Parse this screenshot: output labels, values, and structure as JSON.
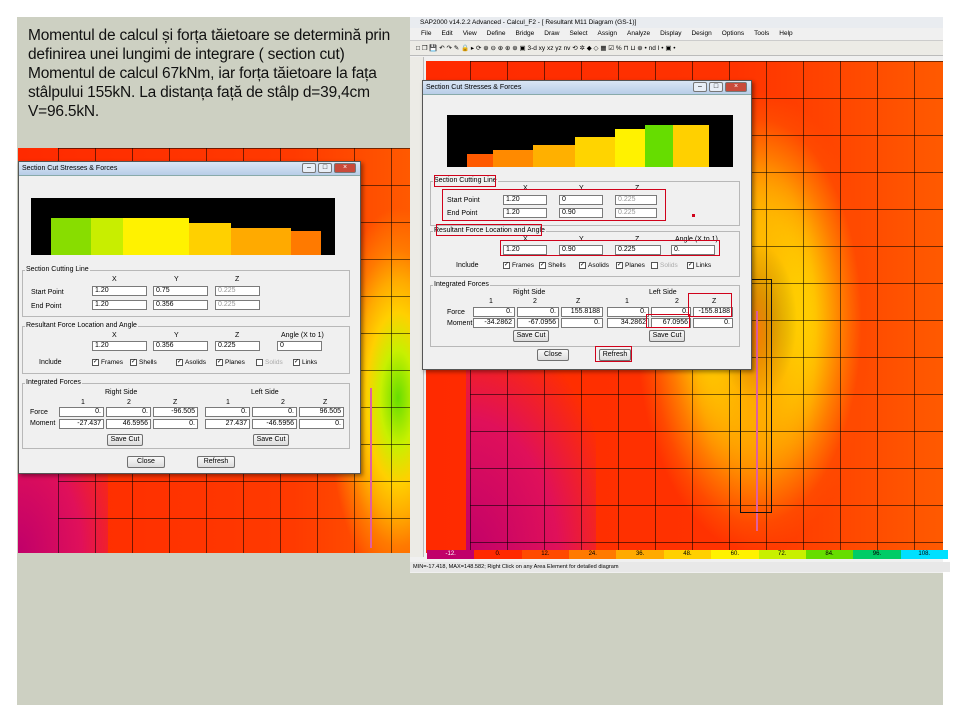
{
  "caption": {
    "line1": "Momentul de calcul și forța tăietoare se determină prin",
    "line2": "definirea unei lungimi de integrare ( section cut)",
    "line3": "Momentul de calcul 67kNm, iar forța tăietoare la fața",
    "line4": "stâlpului 155kN. La distanța față de stâlp d=39,4cm",
    "line5": "V=96.5kN."
  },
  "sap_window": {
    "title": "SAP2000 v14.2.2 Advanced  - Calcul_F2 - [  Resultant M11 Diagram  (GS-1)]",
    "menu": [
      "File",
      "Edit",
      "View",
      "Define",
      "Bridge",
      "Draw",
      "Select",
      "Assign",
      "Analyze",
      "Display",
      "Design",
      "Options",
      "Tools",
      "Help"
    ],
    "toolbar": "□ ❐ 💾 ↶ ↷  ✎  🔒  ▸ ⟳  ⊕ ⊖ ⊕ ⊕ ⊕  ▣  3-d  xy  xz  yz  nv  ⟲  ✲  ◆  ◇  ▦  ☑  %  ⊓ ⊔ ⊕ • nd  I •  ▣ •",
    "legend": [
      "-12.",
      "0.",
      "12.",
      "24.",
      "36.",
      "48.",
      "60.",
      "72.",
      "84.",
      "96.",
      "108."
    ],
    "legend_colors": [
      "#c0006a",
      "#ff2a00",
      "#ff4a00",
      "#ff7a00",
      "#ffaa00",
      "#ffd000",
      "#fff200",
      "#c8f000",
      "#66dd00",
      "#00cc66",
      "#00e0ff"
    ],
    "status": "MIN=-17.418, MAX=148.582; Right Click on any Area Element for detailed diagram"
  },
  "dialogs": {
    "left": {
      "title": "Section Cut Stresses & Forces",
      "section_cutting_line": "Section Cutting Line",
      "resultant": "Resultant Force Location and Angle",
      "integrated": "Integrated Forces",
      "x": "X",
      "y": "Y",
      "z": "Z",
      "angle": "Angle (X to 1)",
      "start_point": "Start Point",
      "end_point": "End Point",
      "start": [
        "1.20",
        "0.75",
        "0.225"
      ],
      "end": [
        "1.20",
        "0.356",
        "0.225"
      ],
      "loc": [
        "1.20",
        "0.356",
        "0.225",
        "0"
      ],
      "include": "Include",
      "checks": [
        "Frames",
        "Shells",
        "Asolids",
        "Planes",
        "Solids",
        "Links"
      ],
      "right_side": "Right Side",
      "left_side": "Left Side",
      "cols": [
        "1",
        "2",
        "Z"
      ],
      "force": "Force",
      "moment": "Moment",
      "force_right": [
        "0.",
        "0.",
        "-96.505"
      ],
      "force_left": [
        "0.",
        "0.",
        "96.505"
      ],
      "moment_right": [
        "-27.437",
        "46.5956",
        "0."
      ],
      "moment_left": [
        "27.437",
        "-46.5956",
        "0."
      ],
      "save_cut": "Save Cut",
      "close": "Close",
      "refresh": "Refresh"
    },
    "right": {
      "title": "Section Cut Stresses & Forces",
      "section_cutting_line": "Section Cutting Line",
      "resultant": "Resultant Force Location and Angle",
      "integrated": "Integrated Forces",
      "x": "X",
      "y": "Y",
      "z": "Z",
      "angle": "Angle (X to 1)",
      "start_point": "Start Point",
      "end_point": "End Point",
      "start": [
        "1.20",
        "0",
        "0.225"
      ],
      "end": [
        "1.20",
        "0.90",
        "0.225"
      ],
      "loc": [
        "1.20",
        "0.90",
        "0.225",
        "0."
      ],
      "include": "Include",
      "checks": [
        "Frames",
        "Shells",
        "Asolids",
        "Planes",
        "Solids",
        "Links"
      ],
      "right_side": "Right Side",
      "left_side": "Left Side",
      "cols": [
        "1",
        "2",
        "Z"
      ],
      "force": "Force",
      "moment": "Moment",
      "force_right": [
        "0.",
        "0.",
        "155.8188"
      ],
      "force_left": [
        "0.",
        "0.",
        "-155.8188"
      ],
      "moment_right": [
        "-34.2862",
        "-67.0956",
        "0."
      ],
      "moment_left": [
        "34.2862",
        "67.0956",
        "0."
      ],
      "save_cut": "Save Cut",
      "close": "Close",
      "refresh": "Refresh"
    }
  }
}
